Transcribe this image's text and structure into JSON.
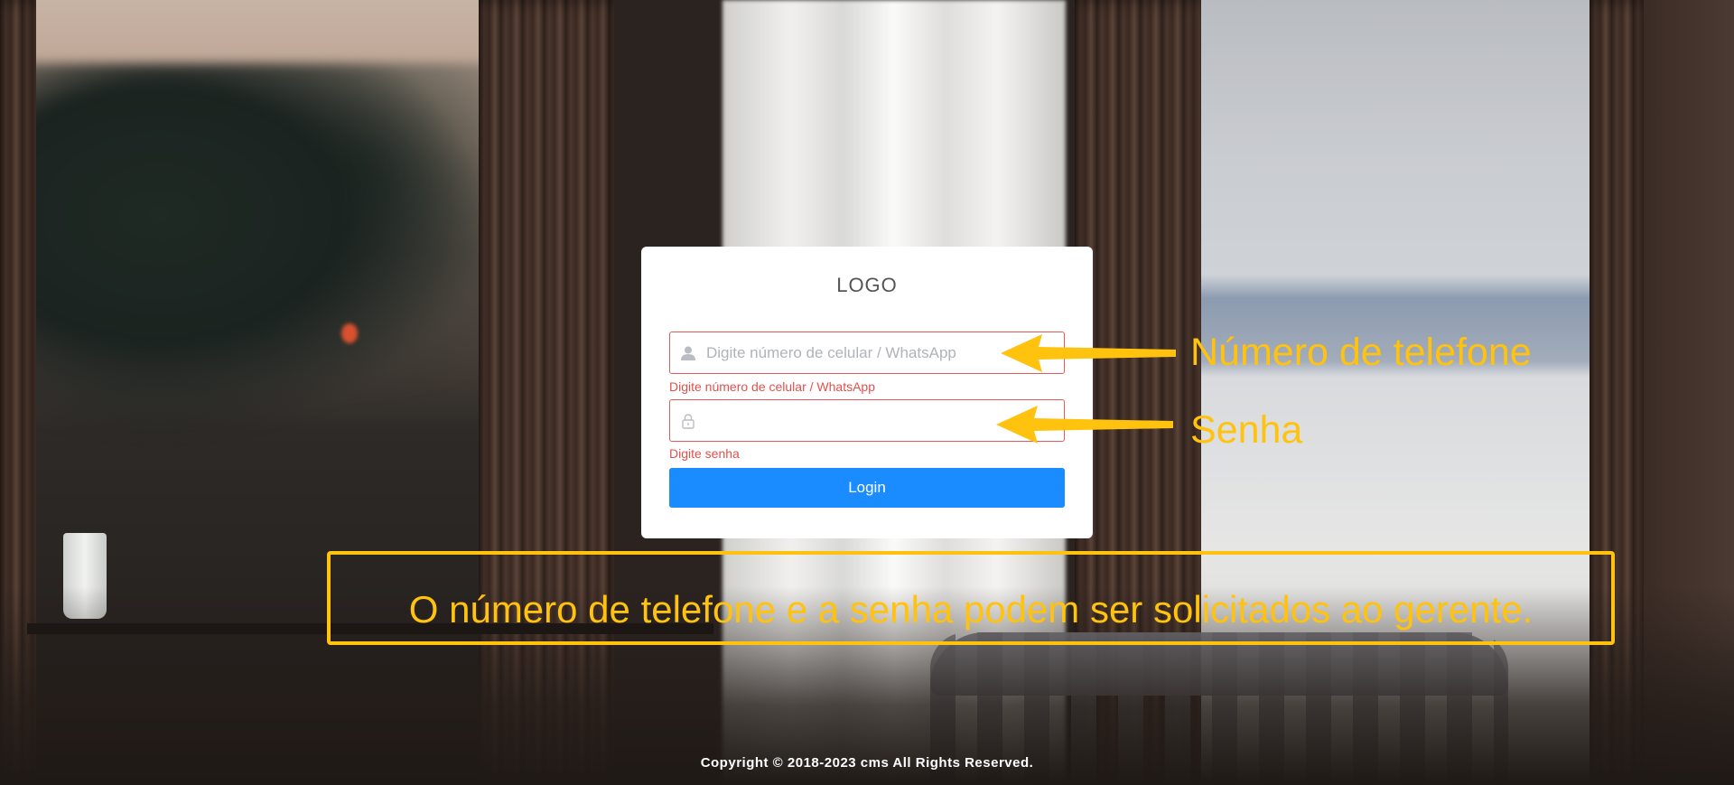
{
  "login": {
    "logo": "LOGO",
    "phone": {
      "placeholder": "Digite número de celular / WhatsApp",
      "value": "",
      "error": "Digite número de celular / WhatsApp",
      "icon": "user-icon"
    },
    "password": {
      "placeholder": "",
      "value": "",
      "error": "Digite senha",
      "icon": "lock-icon"
    },
    "button_label": "Login"
  },
  "annotations": {
    "phone_label": "Número de telefone",
    "password_label": "Senha",
    "note": "O número de telefone e a senha podem ser solicitados ao gerente.",
    "color": "#ffc20e"
  },
  "footer": {
    "copyright": "Copyright © 2018-2023 cms All Rights Reserved."
  },
  "colors": {
    "primary_button": "#1a8cff",
    "error": "#e0504d"
  }
}
